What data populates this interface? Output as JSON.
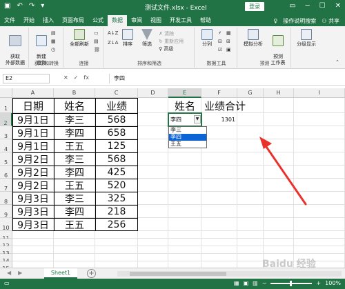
{
  "titlebar": {
    "filename": "测试文件.xlsx - Excel",
    "login": "登录"
  },
  "tabs": [
    "文件",
    "开始",
    "插入",
    "页面布局",
    "公式",
    "数据",
    "审阅",
    "视图",
    "开发工具",
    "帮助"
  ],
  "active_tab": "数据",
  "tab_right": {
    "search": "操作说明搜索",
    "share": "共享"
  },
  "ribbon": {
    "get_external": "获取\n外部数据",
    "new_query": "新建\n查询",
    "refresh_all": "全部刷新",
    "sort": "排序",
    "filter": "筛选",
    "clear": "清除",
    "reapply": "重新应用",
    "advanced": "高级",
    "split": "分列",
    "whatif": "模拟分析",
    "forecast": "预测\n工作表",
    "outline": "分级显示",
    "groups": {
      "get_transform": "获取和转换",
      "connections": "连接",
      "sort_filter": "排序和筛选",
      "data_tools": "数据工具",
      "forecast": "预测"
    }
  },
  "formula_bar": {
    "name_box": "E2",
    "fx": "fx",
    "content": "李四"
  },
  "columns": [
    "A",
    "B",
    "C",
    "D",
    "E",
    "F",
    "G",
    "H",
    "I"
  ],
  "rows": [
    "1",
    "2",
    "3",
    "4",
    "5",
    "6",
    "7",
    "8",
    "9",
    "10",
    "11",
    "12",
    "13",
    "14",
    "15",
    "16",
    "17"
  ],
  "table": {
    "headers": [
      "日期",
      "姓名",
      "业绩"
    ],
    "rows": [
      [
        "9月1日",
        "李三",
        "568"
      ],
      [
        "9月1日",
        "李四",
        "658"
      ],
      [
        "9月1日",
        "王五",
        "125"
      ],
      [
        "9月2日",
        "李三",
        "568"
      ],
      [
        "9月2日",
        "李四",
        "425"
      ],
      [
        "9月2日",
        "王五",
        "520"
      ],
      [
        "9月3日",
        "李三",
        "325"
      ],
      [
        "9月3日",
        "李四",
        "218"
      ],
      [
        "9月3日",
        "王五",
        "256"
      ]
    ]
  },
  "lookup": {
    "name_header": "姓名",
    "total_header": "业绩合计",
    "selected": "李四",
    "total": "1301"
  },
  "dropdown": {
    "options": [
      "李三",
      "李四",
      "王五"
    ],
    "highlighted": "李四"
  },
  "sheets": {
    "active": "Sheet1"
  },
  "statusbar": {
    "zoom": "100%"
  },
  "watermark": "Baidu 经验",
  "colors": {
    "excel_green": "#217346",
    "dropdown_highlight": "#0a64d6",
    "arrow": "#e8322b"
  }
}
